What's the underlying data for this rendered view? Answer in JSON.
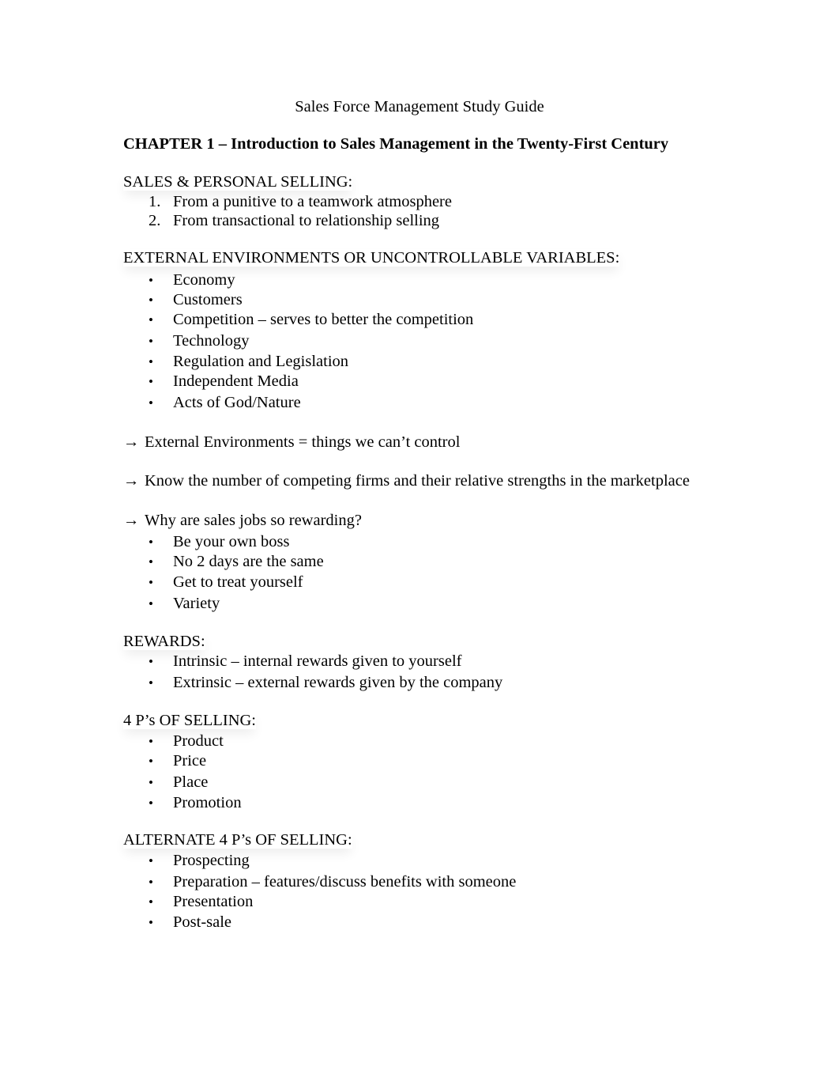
{
  "document": {
    "title": "Sales Force Management Study Guide",
    "chapter": "CHAPTER 1 – Introduction to Sales Management in the Twenty-First Century",
    "sections": {
      "sales_personal": {
        "heading": "SALES & PERSONAL SELLING:",
        "items": [
          {
            "marker": "1.",
            "text": "From a punitive to a teamwork atmosphere"
          },
          {
            "marker": "2.",
            "text": "From transactional to relationship selling"
          }
        ]
      },
      "external": {
        "heading": "EXTERNAL ENVIRONMENTS OR UNCONTROLLABLE VARIABLES:",
        "items": [
          "Economy",
          "Customers",
          "Competition – serves to better the competition",
          "Technology",
          "Regulation and Legislation",
          "Independent Media",
          "Acts of God/Nature"
        ]
      },
      "arrows": [
        "External Environments = things we can’t control",
        "Know the number of competing firms and their relative strengths in the marketplace",
        "Why are sales jobs so rewarding?"
      ],
      "rewarding": {
        "items": [
          "Be your own boss",
          "No 2 days are the same",
          "Get to treat yourself",
          "Variety"
        ]
      },
      "rewards": {
        "heading": "REWARDS:",
        "items": [
          "Intrinsic – internal rewards given to yourself",
          "Extrinsic – external rewards given by the company"
        ]
      },
      "four_ps": {
        "heading": "4 P’s OF SELLING:",
        "items": [
          "Product",
          "Price",
          "Place",
          "Promotion"
        ]
      },
      "alt_four_ps": {
        "heading": "ALTERNATE 4 P’s OF SELLING:",
        "items": [
          "Prospecting",
          "Preparation – features/discuss benefits with someone",
          "Presentation",
          "Post-sale"
        ]
      }
    },
    "icons": {
      "arrow": "→",
      "bullet": "•"
    }
  }
}
